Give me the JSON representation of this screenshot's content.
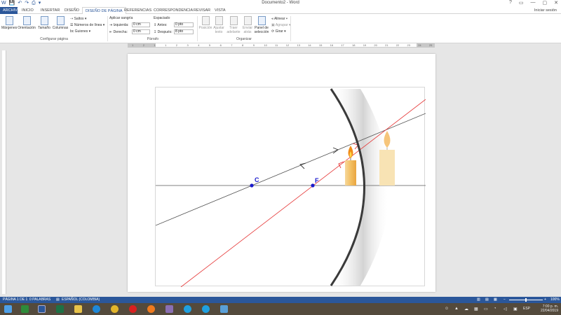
{
  "window": {
    "title": "Documento2 - Word",
    "sign_in": "Iniciar sesión",
    "qat": [
      "W",
      "💾",
      "↶",
      "↷",
      "⎙",
      "▾"
    ],
    "controls": [
      "?",
      "▭",
      "—",
      "▢",
      "✕"
    ]
  },
  "tabs": [
    "ARCHIVO",
    "INICIO",
    "INSERTAR",
    "DISEÑO",
    "DISEÑO DE PÁGINA",
    "REFERENCIAS",
    "CORRESPONDENCIA",
    "REVISAR",
    "VISTA"
  ],
  "ribbon": {
    "configurar": {
      "margenes": "Márgenes",
      "orientacion": "Orientación",
      "tamano": "Tamaño",
      "columnas": "Columnas",
      "saltos": "Saltos",
      "numeros_linea": "Números de línea",
      "guiones": "Guiones",
      "group": "Configurar página"
    },
    "parrafo": {
      "aplicar_sangria": "Aplicar sangría",
      "izquierda": "Izquierda:",
      "izquierda_val": "0 cm",
      "derecha": "Derecha:",
      "derecha_val": "0 cm",
      "espaciado": "Espaciado",
      "antes": "Antes:",
      "antes_val": "0 pto",
      "despues": "Después:",
      "despues_val": "8 pto",
      "group": "Párrafo"
    },
    "organizar": {
      "posicion": "Posición",
      "ajustar_texto": "Ajustar texto",
      "traer_adelante": "Traer adelante",
      "enviar_atras": "Enviar atrás",
      "panel_seleccion": "Panel de selección",
      "alinear": "Alinear",
      "agrupar": "Agrupar",
      "girar": "Girar",
      "group": "Organizar"
    }
  },
  "ruler": [
    "1",
    "2",
    "1",
    "1",
    "2",
    "3",
    "4",
    "5",
    "6",
    "7",
    "8",
    "9",
    "10",
    "11",
    "12",
    "13",
    "14",
    "15",
    "16",
    "17",
    "18",
    "19",
    "20",
    "21",
    "22",
    "23",
    "24",
    "25"
  ],
  "figure": {
    "label_c": "C",
    "label_f": "F",
    "colors": {
      "axis": "#808080",
      "ray_black": "#505050",
      "ray_red": "#e53333",
      "mirror": "#3a3a3a",
      "point": "#1a1acc",
      "candle": "#f3c063",
      "flame": "#f08a16"
    }
  },
  "status": {
    "page": "PÁGINA 1 DE 1",
    "words": "0 PALABRAS",
    "lang": "ESPAÑOL (COLOMBIA)",
    "zoom": "100%"
  },
  "taskbar": {
    "icons": [
      "start-icon",
      "task-view-icon",
      "excel-green-icon",
      "word-icon",
      "excel-icon",
      "explorer-icon",
      "edge-icon",
      "chrome-icon",
      "opera-icon",
      "firefox-icon",
      "photos-icon",
      "skype-icon",
      "skype2-icon",
      "app-icon"
    ],
    "lang": "ESP",
    "time": "7:00 p. m.",
    "date": "22/04/2019"
  }
}
